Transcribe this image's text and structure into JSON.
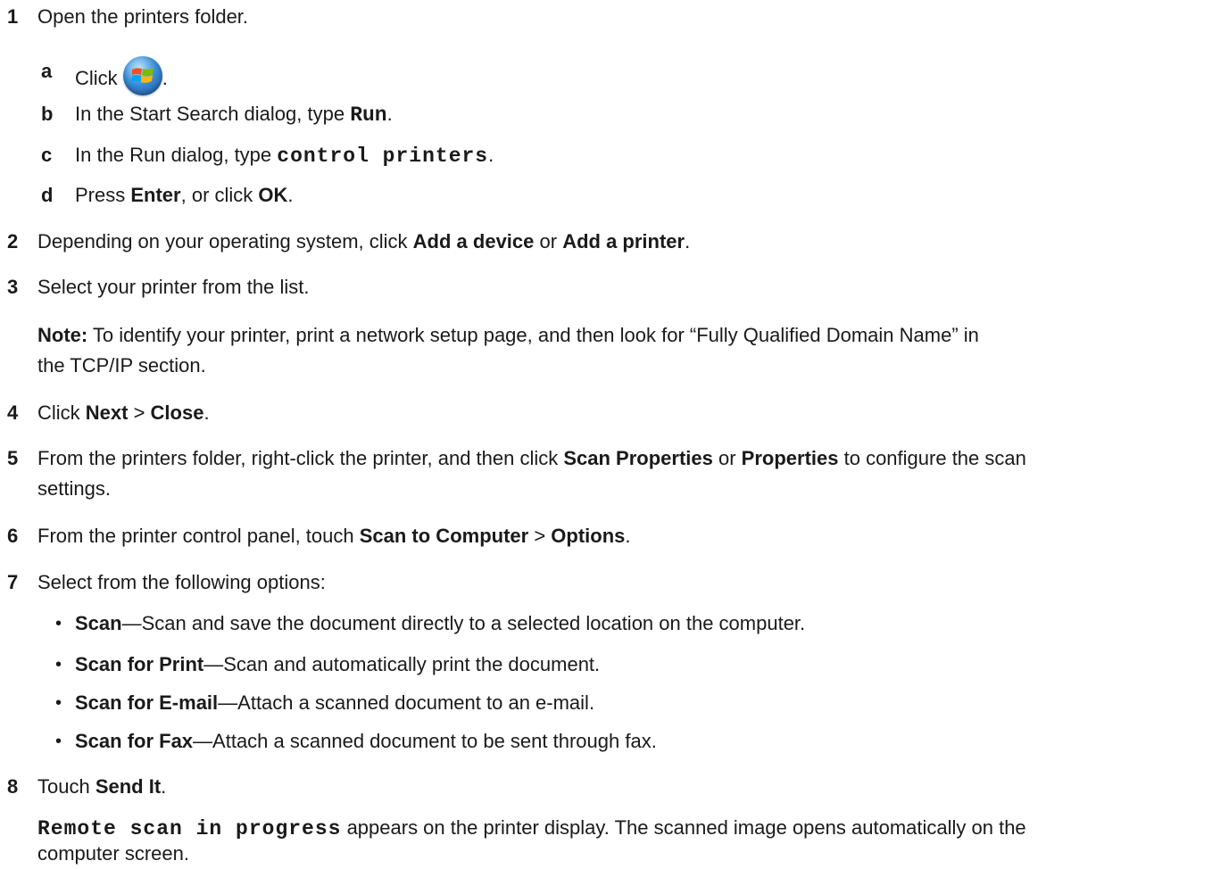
{
  "steps": {
    "s1": {
      "num": "1",
      "text": "Open the printers folder."
    },
    "s1a": {
      "letter": "a",
      "text": "Click",
      "after": ".",
      "icon": "windows-start-icon"
    },
    "s1b": {
      "letter": "b",
      "pre": "In the Start Search dialog, type ",
      "code": "Run",
      "post": "."
    },
    "s1c": {
      "letter": "c",
      "pre": "In the Run dialog, type ",
      "code": "control printers",
      "post": "."
    },
    "s1d": {
      "letter": "d",
      "pre": "Press ",
      "b1": "Enter",
      "mid": ", or click ",
      "b2": "OK",
      "post": "."
    },
    "s2": {
      "num": "2",
      "pre": "Depending on your operating system, click ",
      "b1": "Add a device",
      "mid": " or ",
      "b2": "Add a printer",
      "post": "."
    },
    "s3": {
      "num": "3",
      "text": "Select your printer from the list."
    },
    "note": {
      "label": "Note:",
      "line1": " To identify your printer, print a network setup page, and then look for “Fully Qualified Domain Name” in",
      "line2": "the TCP/IP section."
    },
    "s4": {
      "num": "4",
      "pre": "Click ",
      "b1": "Next",
      "mid": " > ",
      "b2": "Close",
      "post": "."
    },
    "s5": {
      "num": "5",
      "pre": "From the printers folder, right-click the printer, and then click ",
      "b1": "Scan Properties",
      "mid": " or ",
      "b2": "Properties",
      "post": " to configure the scan",
      "line2": "settings."
    },
    "s6": {
      "num": "6",
      "pre": "From the printer control panel, touch ",
      "b1": "Scan to Computer",
      "mid": " > ",
      "b2": "Options",
      "post": "."
    },
    "s7": {
      "num": "7",
      "text": "Select from the following options:"
    },
    "options": [
      {
        "label": "Scan",
        "desc": "—Scan and save the document directly to a selected location on the computer."
      },
      {
        "label": "Scan for Print",
        "desc": "—Scan and automatically print the document."
      },
      {
        "label": "Scan for E-mail",
        "desc": "—Attach a scanned document to an e-mail."
      },
      {
        "label": "Scan for Fax",
        "desc": "—Attach a scanned document to be sent through fax."
      }
    ],
    "s8": {
      "num": "8",
      "pre": "Touch ",
      "b1": "Send It",
      "post": "."
    },
    "result": {
      "code": "Remote scan in progress",
      "line1": " appears on the printer display. The scanned image opens automatically on the",
      "line2": "computer screen."
    }
  },
  "bullet_char": "•"
}
